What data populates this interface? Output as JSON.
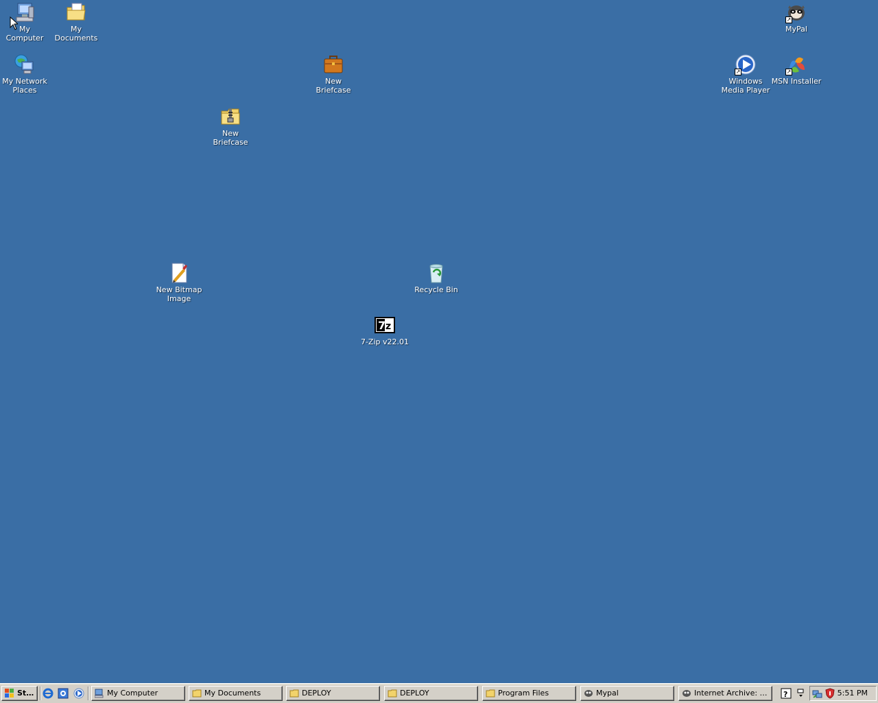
{
  "desktop": {
    "background_color": "#3a6ea5",
    "icons": [
      {
        "label": "My Computer",
        "icon": "computer-icon"
      },
      {
        "label": "My Documents",
        "icon": "documents-folder-icon"
      },
      {
        "label": "MyPal",
        "icon": "mypal-icon",
        "shortcut": true
      },
      {
        "label": "My Network Places",
        "icon": "network-places-icon"
      },
      {
        "label": "New Briefcase",
        "icon": "briefcase-icon"
      },
      {
        "label": "Windows Media Player",
        "icon": "media-player-icon",
        "shortcut": true
      },
      {
        "label": "MSN Installer",
        "icon": "msn-icon",
        "shortcut": true
      },
      {
        "label": "New Briefcase",
        "icon": "zip-folder-icon"
      },
      {
        "label": "New Bitmap Image",
        "icon": "paint-bitmap-icon"
      },
      {
        "label": "Recycle Bin",
        "icon": "recycle-bin-icon"
      },
      {
        "label": "7-Zip v22.01",
        "icon": "seven-zip-icon"
      }
    ]
  },
  "taskbar": {
    "start_label": "Start",
    "quick_launch": [
      "internet-explorer-icon",
      "outlook-express-icon",
      "media-player-icon"
    ],
    "tasks": [
      {
        "label": "My Computer",
        "icon": "computer-icon"
      },
      {
        "label": "My Documents",
        "icon": "folder-icon"
      },
      {
        "label": "DEPLOY",
        "icon": "folder-icon"
      },
      {
        "label": "DEPLOY",
        "icon": "folder-icon"
      },
      {
        "label": "Program Files",
        "icon": "folder-icon"
      },
      {
        "label": "Mypal",
        "icon": "mypal-icon"
      },
      {
        "label": "Internet Archive: Vie...",
        "icon": "mypal-icon"
      }
    ],
    "tray": {
      "help_icon": "help-icon",
      "icons": [
        "network-icon",
        "security-shield-icon"
      ],
      "clock": "5:51 PM"
    }
  }
}
